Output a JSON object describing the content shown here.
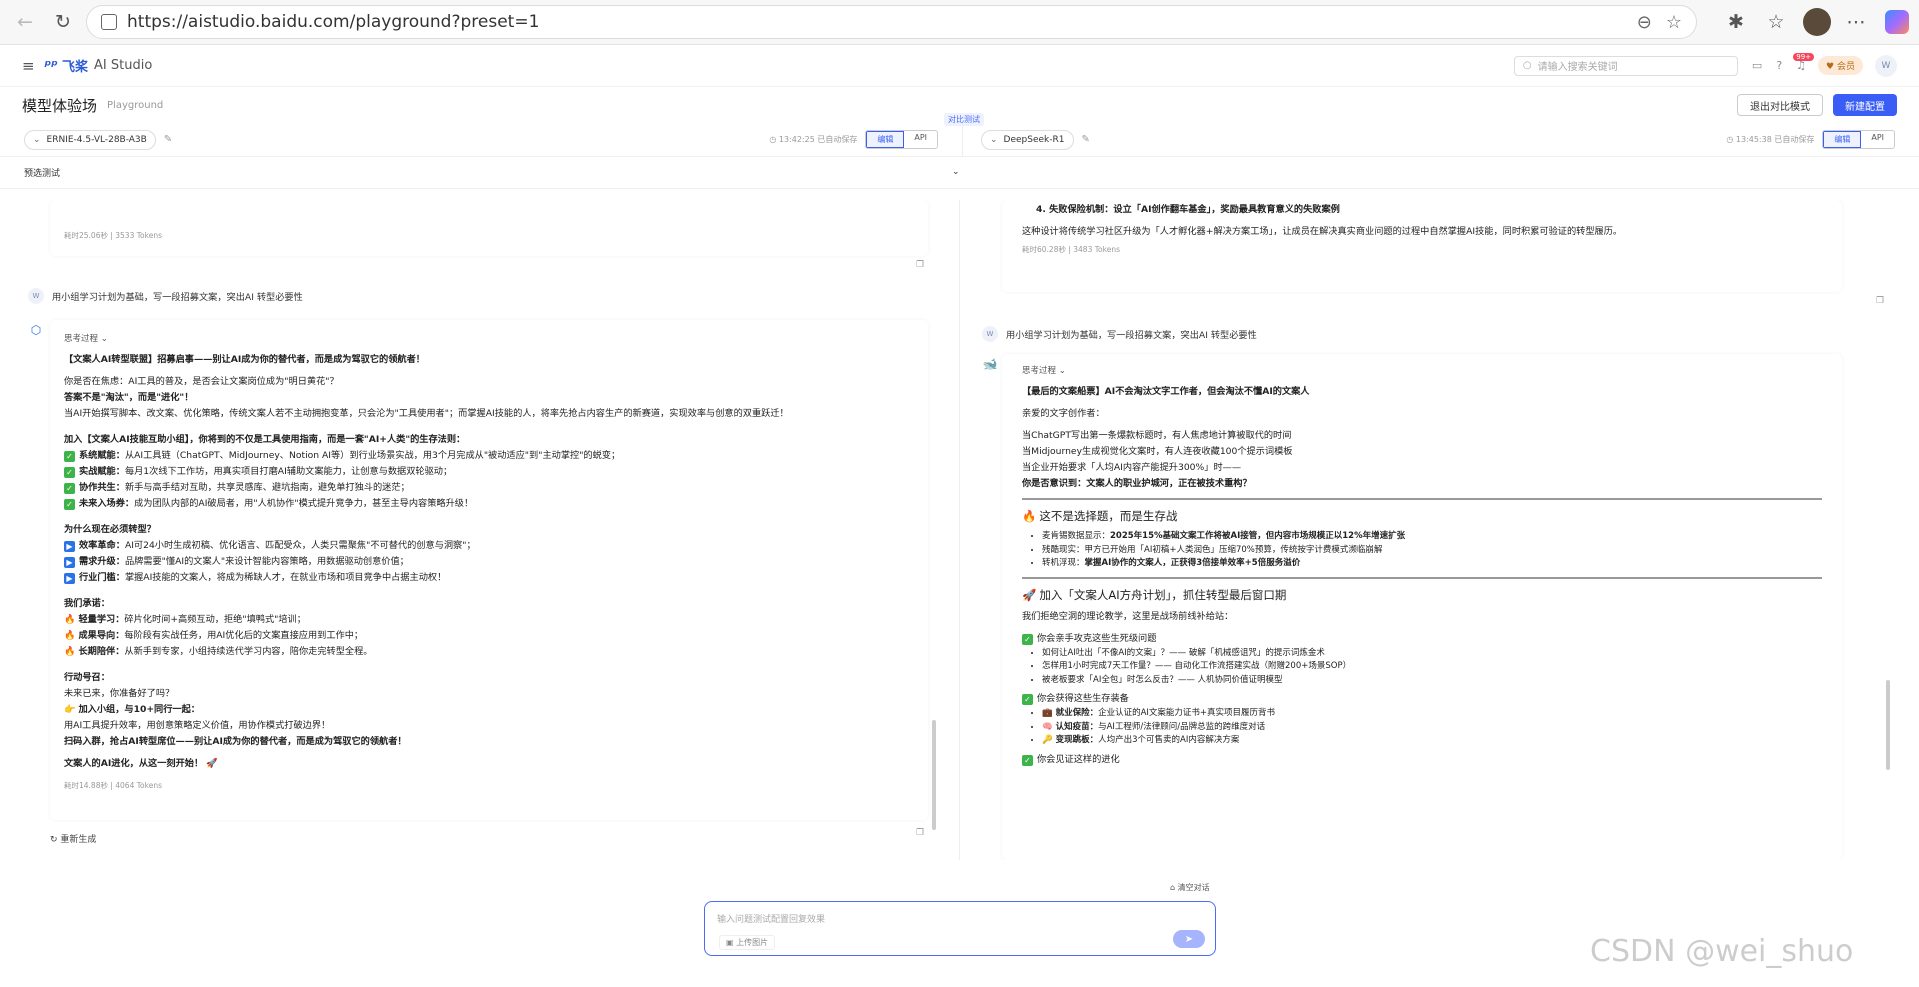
{
  "browser": {
    "url": "https://aistudio.baidu.com/playground?preset=1"
  },
  "header": {
    "logo_mark": "飞桨",
    "logo_text": "AI Studio",
    "search_placeholder": "请输入搜索关键词",
    "notify_count": "99+",
    "member_label": "会员",
    "user_initial": "W"
  },
  "titlebar": {
    "title": "模型体验场",
    "subtitle": "Playground",
    "compare_tag": "对比测试",
    "exit_compare": "退出对比模式",
    "new_config": "新建配置"
  },
  "left_model": {
    "name": "ERNIE-4.5-VL-28B-A3B",
    "saved": "13:42:25 已自动保存",
    "tab_edit": "编辑",
    "tab_api": "API"
  },
  "right_model": {
    "name": "DeepSeek-R1",
    "saved": "13:45:38 已自动保存",
    "tab_edit": "编辑",
    "tab_api": "API"
  },
  "preset_label": "预选测试",
  "left": {
    "prev_meta": "耗时25.06秒 | 3533 Tokens",
    "user_prompt": "用小组学习计划为基础，写一段招募文案，突出AI 转型必要性",
    "user_initial": "W",
    "think_label": "思考过程",
    "title": "【文案人AI转型联盟】招募启事——别让AI成为你的替代者，而是成为驾驭它的领航者！",
    "p1a": "你是否在焦虑：AI工具的普及，是否会让文案岗位成为\"明日黄花\"？",
    "p1b": "答案不是\"淘汰\"，而是\"进化\"！",
    "p1c": "当AI开始撰写脚本、改文案、优化策略，传统文案人若不主动拥抱变革，只会沦为\"工具使用者\"；而掌握AI技能的人，将率先抢占内容生产的新赛道，实现效率与创意的双重跃迁！",
    "join_title": "加入【文案人AI技能互助小组】，你将到的不仅是工具使用指南，而是一套\"AI+人类\"的生存法则：",
    "join": [
      {
        "k": "系统赋能：",
        "v": "从AI工具链（ChatGPT、MidJourney、Notion AI等）到行业场景实战，用3个月完成从\"被动适应\"到\"主动掌控\"的蜕变；"
      },
      {
        "k": "实战赋能：",
        "v": "每月1次线下工作坊，用真实项目打磨AI辅助文案能力，让创意与数据双轮驱动；"
      },
      {
        "k": "协作共生：",
        "v": "新手与高手结对互助，共享灵感库、避坑指南，避免单打独斗的迷茫；"
      },
      {
        "k": "未来入场券：",
        "v": "成为团队内部的AI破局者，用\"人机协作\"模式提升竞争力，甚至主导内容策略升级！"
      }
    ],
    "why_title": "为什么现在必须转型？",
    "why": [
      {
        "k": "效率革命：",
        "v": "AI可24小时生成初稿、优化语言、匹配受众，人类只需聚焦\"不可替代的创意与洞察\"；"
      },
      {
        "k": "需求升级：",
        "v": "品牌需要\"懂AI的文案人\"来设计智能内容策略，用数据驱动创意价值；"
      },
      {
        "k": "行业门槛：",
        "v": "掌握AI技能的文案人，将成为稀缺人才，在就业市场和项目竞争中占据主动权！"
      }
    ],
    "promise_title": "我们承诺：",
    "promise": [
      {
        "k": "轻量学习：",
        "v": "碎片化时间+高频互动，拒绝\"填鸭式\"培训；"
      },
      {
        "k": "成果导向：",
        "v": "每阶段有实战任务，用AI优化后的文案直接应用到工作中；"
      },
      {
        "k": "长期陪伴：",
        "v": "从新手到专家，小组持续迭代学习内容，陪你走完转型全程。"
      }
    ],
    "action_title": "行动号召：",
    "action1": "未来已来，你准备好了吗？",
    "action2": "加入小组，与10+同行一起：",
    "action3": "用AI工具提升效率，用创意策略定义价值，用协作模式打破边界！",
    "action4": "扫码入群，抢占AI转型席位——别让AI成为你的替代者，而是成为驾驭它的领航者！",
    "closing": "文案人的AI进化，从这一刻开始！ 🚀",
    "meta": "耗时14.88秒 | 4064 Tokens",
    "regen": "重新生成"
  },
  "right": {
    "prev_item": "4. 失败保险机制：设立「AI创作翻车基金」，奖励最具教育意义的失败案例",
    "prev_para": "这种设计将传统学习社区升级为「人才孵化器+解决方案工场」，让成员在解决真实商业问题的过程中自然掌握AI技能，同时积累可验证的转型履历。",
    "prev_meta": "耗时60.28秒 | 3483 Tokens",
    "user_prompt": "用小组学习计划为基础，写一段招募文案，突出AI 转型必要性",
    "user_initial": "W",
    "think_label": "思考过程",
    "title": "【最后的文案船票】AI不会淘汰文字工作者，但会淘汰不懂AI的文案人",
    "greet": "亲爱的文字创作者：",
    "lines": [
      "当ChatGPT写出第一条爆款标题时，有人焦虑地计算被取代的时间",
      "当Midjourney生成视觉化文案时，有人连夜收藏100个提示词模板",
      "当企业开始要求「人均AI内容产能提升300%」时——"
    ],
    "lines_b": "你是否意识到：文案人的职业护城河，正在被技术重构？",
    "h_fire": "这不是选择题，而是生存战",
    "fire": [
      {
        "k": "麦肯锡数据显示：",
        "v": "2025年15%基础文案工作将被AI接管，但内容市场规模正以12%年增速扩张",
        "bold": true
      },
      {
        "k": "残酷现实：",
        "v": "甲方已开始用「AI初稿+人类润色」压缩70%预算，传统按字计费模式濒临崩解",
        "bold": false
      },
      {
        "k": "转机浮现：",
        "v": "掌握AI协作的文案人，正获得3倍接单效率+5倍服务溢价",
        "bold": true
      }
    ],
    "h_rocket": "加入「文案人AI方舟计划」，抓住转型最后窗口期",
    "rocket_intro": "我们拒绝空洞的理论教学，这里是战场前线补给站：",
    "c1": "你会亲手攻克这些生死级问题",
    "c1_items": [
      "如何让AI吐出「不像AI的文案」？—— 破解「机械感诅咒」的提示词炼金术",
      "怎样用1小时完成7天工作量？—— 自动化工作流搭建实战（附赠200+场景SOP）",
      "被老板要求「AI全包」时怎么反击？—— 人机协同价值证明模型"
    ],
    "c2": "你会获得这些生存装备",
    "c2_items": [
      {
        "em": "💼",
        "k": "就业保险：",
        "v": "企业认证的AI文案能力证书+真实项目履历背书"
      },
      {
        "em": "🧠",
        "k": "认知疫苗：",
        "v": "与AI工程师/法律顾问/品牌总监的跨维度对话"
      },
      {
        "em": "🔑",
        "k": "变现跳板：",
        "v": "人均产出3个可售卖的AI内容解决方案"
      }
    ],
    "c3": "你会见证这样的进化"
  },
  "input": {
    "placeholder": "输入问题测试配置回复效果",
    "upload": "上传图片",
    "clear": "清空对话"
  },
  "watermark": "CSDN @wei_shuo"
}
